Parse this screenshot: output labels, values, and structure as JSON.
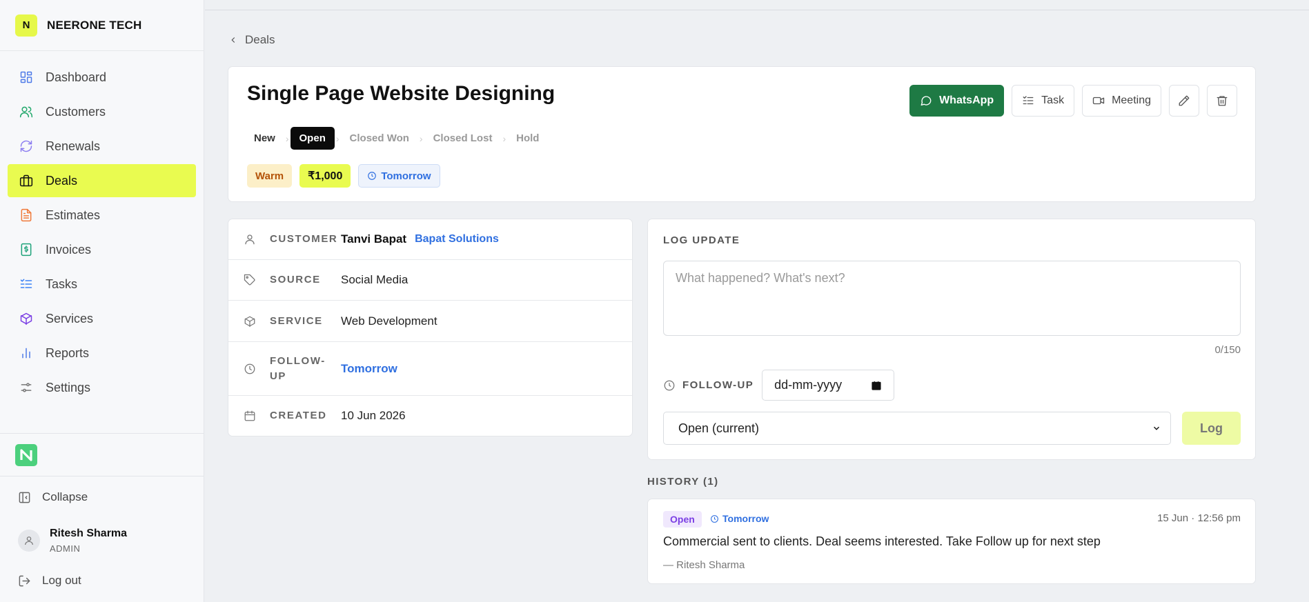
{
  "brand": {
    "logo_letter": "N",
    "name": "NEERONE TECH",
    "accent": "#e9fb50"
  },
  "sidebar": {
    "items": [
      {
        "label": "Dashboard",
        "icon": "grid-icon",
        "color": "#4f7be8"
      },
      {
        "label": "Customers",
        "icon": "users-icon",
        "color": "#22a86b"
      },
      {
        "label": "Renewals",
        "icon": "refresh-icon",
        "color": "#8b7cf0"
      },
      {
        "label": "Deals",
        "icon": "briefcase-icon",
        "color": "#111111",
        "active": true
      },
      {
        "label": "Estimates",
        "icon": "file-text-icon",
        "color": "#f07a3a"
      },
      {
        "label": "Invoices",
        "icon": "invoice-icon",
        "color": "#1fa37a"
      },
      {
        "label": "Tasks",
        "icon": "checklist-icon",
        "color": "#3b82f6"
      },
      {
        "label": "Services",
        "icon": "box-icon",
        "color": "#7b3fe4"
      },
      {
        "label": "Reports",
        "icon": "bar-chart-icon",
        "color": "#4f7be8"
      },
      {
        "label": "Settings",
        "icon": "sliders-icon",
        "color": "#777777"
      }
    ],
    "collapse_label": "Collapse",
    "user": {
      "name": "Ritesh Sharma",
      "role": "ADMIN"
    },
    "logout_label": "Log out"
  },
  "breadcrumb": {
    "label": "Deals"
  },
  "deal": {
    "title": "Single Page Website Designing",
    "stages": [
      "New",
      "Open",
      "Closed Won",
      "Closed Lost",
      "Hold"
    ],
    "current_stage": "Open",
    "tags": {
      "temperature": "Warm",
      "amount": "₹1,000",
      "follow_up": "Tomorrow"
    }
  },
  "actions": {
    "whatsapp": "WhatsApp",
    "task": "Task",
    "meeting": "Meeting",
    "whatsapp_color": "#1e7a44"
  },
  "details": {
    "customer_label": "CUSTOMER",
    "customer_name": "Tanvi Bapat",
    "customer_company": "Bapat Solutions",
    "source_label": "SOURCE",
    "source": "Social Media",
    "service_label": "SERVICE",
    "service": "Web Development",
    "followup_label_1": "FOLLOW-",
    "followup_label_2": "UP",
    "followup": "Tomorrow",
    "created_label": "CREATED",
    "created": "10 Jun 2026"
  },
  "log_update": {
    "label": "LOG UPDATE",
    "placeholder": "What happened? What's next?",
    "counter": "0/150",
    "followup_label": "FOLLOW-UP",
    "date_placeholder": "dd-mm-yyyy",
    "status_selected": "Open (current)",
    "log_button": "Log"
  },
  "history": {
    "label": "HISTORY (1)",
    "entries": [
      {
        "status": "Open",
        "due": "Tomorrow",
        "time": "15 Jun · 12:56 pm",
        "text": "Commercial sent to clients. Deal seems interested. Take Follow up for next step",
        "author": "— Ritesh Sharma"
      }
    ]
  }
}
